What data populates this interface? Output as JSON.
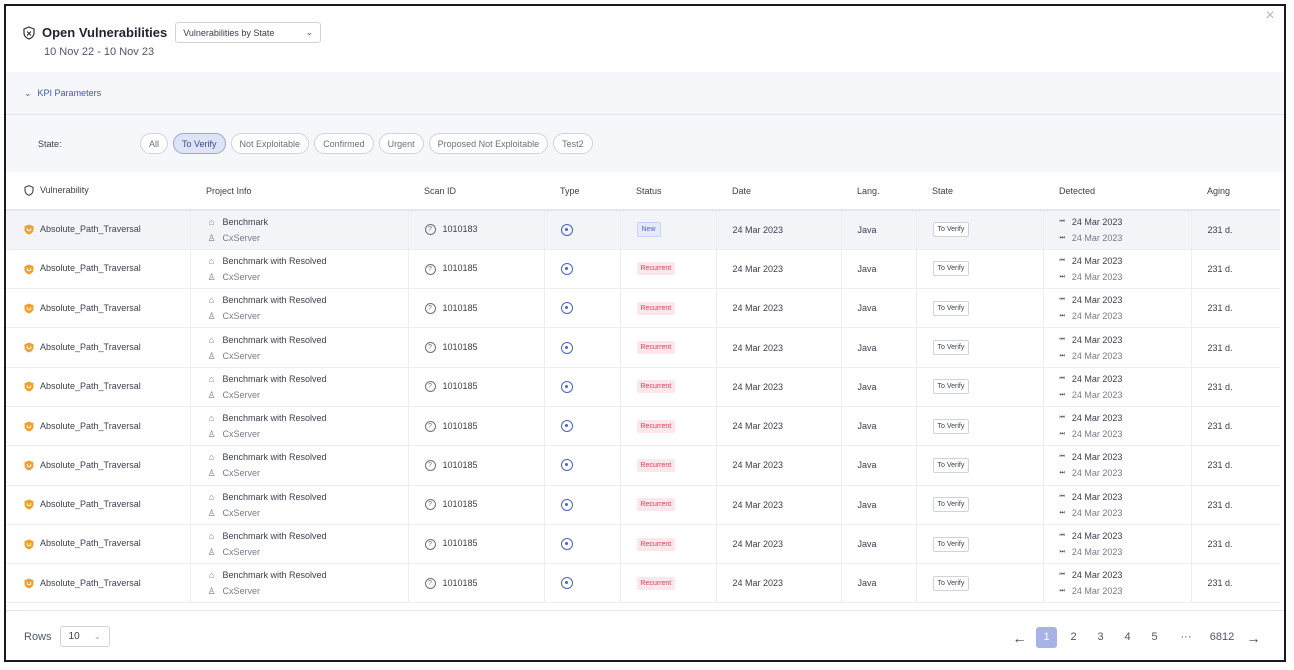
{
  "header": {
    "title": "Open Vulnerabilities",
    "view_select": "Vulnerabilities by State",
    "date_range": "10 Nov 22 - 10 Nov 23"
  },
  "kpi": {
    "label": "KPI Parameters"
  },
  "filters": {
    "label": "State:",
    "chips": [
      "All",
      "To Verify",
      "Not Exploitable",
      "Confirmed",
      "Urgent",
      "Proposed Not Exploitable",
      "Test2"
    ],
    "active": "To Verify"
  },
  "table": {
    "columns": [
      "Vulnerability",
      "Project Info",
      "Scan ID",
      "Type",
      "Status",
      "Date",
      "Lang.",
      "State",
      "Detected",
      "Aging"
    ],
    "rows": [
      {
        "vuln": "Absolute_Path_Traversal",
        "project": "Benchmark",
        "server": "CxServer",
        "scan_id": "1010183",
        "status": "New",
        "date": "24 Mar 2023",
        "lang": "Java",
        "state": "To Verify",
        "det1": "24 Mar 2023",
        "det2": "24 Mar 2023",
        "aging": "231 d."
      },
      {
        "vuln": "Absolute_Path_Traversal",
        "project": "Benchmark with Resolved",
        "server": "CxServer",
        "scan_id": "1010185",
        "status": "Recurrent",
        "date": "24 Mar 2023",
        "lang": "Java",
        "state": "To Verify",
        "det1": "24 Mar 2023",
        "det2": "24 Mar 2023",
        "aging": "231 d."
      },
      {
        "vuln": "Absolute_Path_Traversal",
        "project": "Benchmark with Resolved",
        "server": "CxServer",
        "scan_id": "1010185",
        "status": "Recurrent",
        "date": "24 Mar 2023",
        "lang": "Java",
        "state": "To Verify",
        "det1": "24 Mar 2023",
        "det2": "24 Mar 2023",
        "aging": "231 d."
      },
      {
        "vuln": "Absolute_Path_Traversal",
        "project": "Benchmark with Resolved",
        "server": "CxServer",
        "scan_id": "1010185",
        "status": "Recurrent",
        "date": "24 Mar 2023",
        "lang": "Java",
        "state": "To Verify",
        "det1": "24 Mar 2023",
        "det2": "24 Mar 2023",
        "aging": "231 d."
      },
      {
        "vuln": "Absolute_Path_Traversal",
        "project": "Benchmark with Resolved",
        "server": "CxServer",
        "scan_id": "1010185",
        "status": "Recurrent",
        "date": "24 Mar 2023",
        "lang": "Java",
        "state": "To Verify",
        "det1": "24 Mar 2023",
        "det2": "24 Mar 2023",
        "aging": "231 d."
      },
      {
        "vuln": "Absolute_Path_Traversal",
        "project": "Benchmark with Resolved",
        "server": "CxServer",
        "scan_id": "1010185",
        "status": "Recurrent",
        "date": "24 Mar 2023",
        "lang": "Java",
        "state": "To Verify",
        "det1": "24 Mar 2023",
        "det2": "24 Mar 2023",
        "aging": "231 d."
      },
      {
        "vuln": "Absolute_Path_Traversal",
        "project": "Benchmark with Resolved",
        "server": "CxServer",
        "scan_id": "1010185",
        "status": "Recurrent",
        "date": "24 Mar 2023",
        "lang": "Java",
        "state": "To Verify",
        "det1": "24 Mar 2023",
        "det2": "24 Mar 2023",
        "aging": "231 d."
      },
      {
        "vuln": "Absolute_Path_Traversal",
        "project": "Benchmark with Resolved",
        "server": "CxServer",
        "scan_id": "1010185",
        "status": "Recurrent",
        "date": "24 Mar 2023",
        "lang": "Java",
        "state": "To Verify",
        "det1": "24 Mar 2023",
        "det2": "24 Mar 2023",
        "aging": "231 d."
      },
      {
        "vuln": "Absolute_Path_Traversal",
        "project": "Benchmark with Resolved",
        "server": "CxServer",
        "scan_id": "1010185",
        "status": "Recurrent",
        "date": "24 Mar 2023",
        "lang": "Java",
        "state": "To Verify",
        "det1": "24 Mar 2023",
        "det2": "24 Mar 2023",
        "aging": "231 d."
      },
      {
        "vuln": "Absolute_Path_Traversal",
        "project": "Benchmark with Resolved",
        "server": "CxServer",
        "scan_id": "1010185",
        "status": "Recurrent",
        "date": "24 Mar 2023",
        "lang": "Java",
        "state": "To Verify",
        "det1": "24 Mar 2023",
        "det2": "24 Mar 2023",
        "aging": "231 d."
      }
    ]
  },
  "pagination": {
    "rows_label": "Rows",
    "rows_value": "10",
    "pages": [
      "1",
      "2",
      "3",
      "4",
      "5",
      "···",
      "6812"
    ],
    "current": "1"
  },
  "colors": {
    "accent": "#4a63c8",
    "recurrent": "#e0405c",
    "vuln_icon": "#f0a030"
  }
}
